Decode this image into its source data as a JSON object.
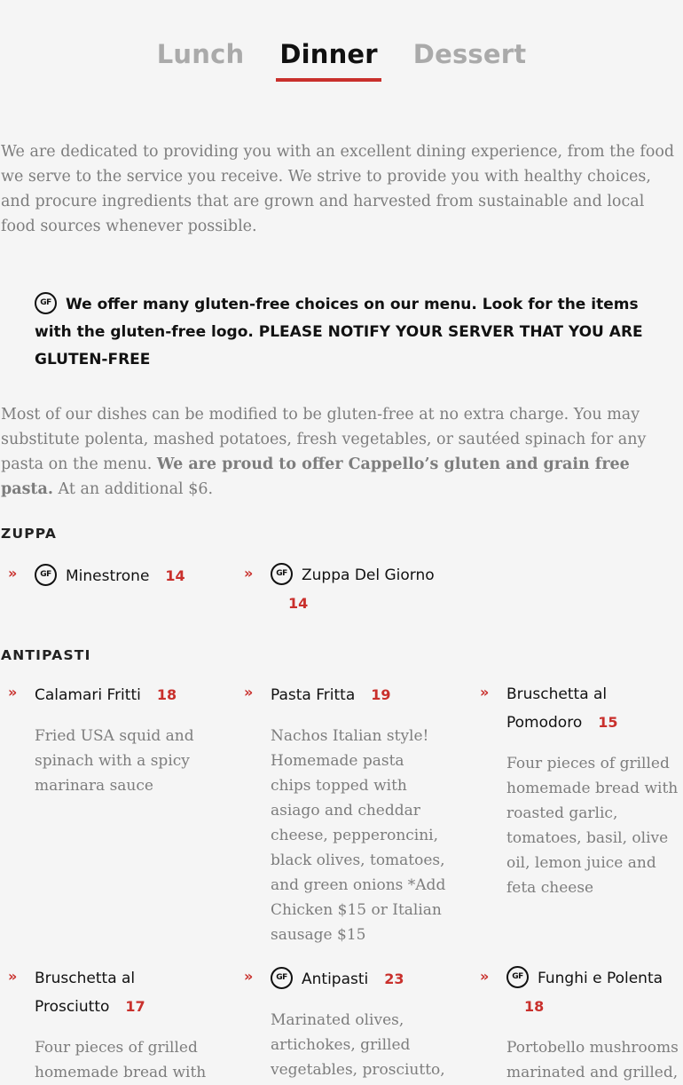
{
  "tabs": [
    "Lunch",
    "Dinner",
    "Dessert"
  ],
  "active_tab": "Dinner",
  "intro": "We are dedicated to providing you with an excellent dining experience, from the food we serve to the service you receive. We strive to provide you with healthy choices, and procure ingredients that are grown and harvested from sustainable and local food sources whenever possible.",
  "gluten_notice": {
    "icon": "gluten-free-icon",
    "icon_text": "GF",
    "text": "We offer many gluten-free choices on our menu. Look for the items with the gluten-free logo. PLEASE NOTIFY YOUR SERVER THAT YOU ARE GLUTEN-FREE"
  },
  "substitution": {
    "text": "Most of our dishes can be modified to be gluten-free at no extra charge. You may substitute polenta, mashed potatoes, fresh vegetables, or sautéed spinach for any pasta on the menu.",
    "bold": "We are proud to offer Cappello’s gluten and grain free pasta.",
    "extra": "At an additional $6."
  },
  "sections": [
    {
      "title": "ZUPPA",
      "items": [
        {
          "name": "Minestrone",
          "price": "14",
          "gf": true,
          "description": ""
        },
        {
          "name": "Zuppa Del Giorno",
          "price": "14",
          "gf": true,
          "description": ""
        }
      ]
    },
    {
      "title": "ANTIPASTI",
      "items": [
        {
          "name": "Calamari Fritti",
          "price": "18",
          "gf": false,
          "description": "Fried USA squid and spinach with a spicy marinara sauce"
        },
        {
          "name": "Pasta Fritta",
          "price": "19",
          "gf": false,
          "description": "Nachos Italian style! Homemade pasta chips topped with asiago and cheddar cheese, pepperoncini, black olives, tomatoes, and green onions *Add Chicken $15 or Italian sausage $15"
        },
        {
          "name": "Bruschetta al Pomodoro",
          "price": "15",
          "gf": false,
          "description": "Four pieces of grilled homemade bread with roasted garlic, tomatoes, basil, olive oil, lemon juice and feta cheese"
        },
        {
          "name": "Bruschetta al Prosciutto",
          "price": "17",
          "gf": false,
          "description": "Four pieces of grilled homemade bread with"
        },
        {
          "name": "Antipasti",
          "price": "23",
          "gf": true,
          "description": "Marinated olives, artichokes, grilled vegetables, prosciutto,"
        },
        {
          "name": "Funghi e Polenta",
          "price": "18",
          "gf": true,
          "description": "Portobello mushrooms marinated and grilled,"
        }
      ]
    }
  ],
  "colors": {
    "accent": "#c9302c",
    "muted_text": "#7d7d7d",
    "inactive_tab": "#aaaaaa",
    "background": "#f5f5f5"
  }
}
